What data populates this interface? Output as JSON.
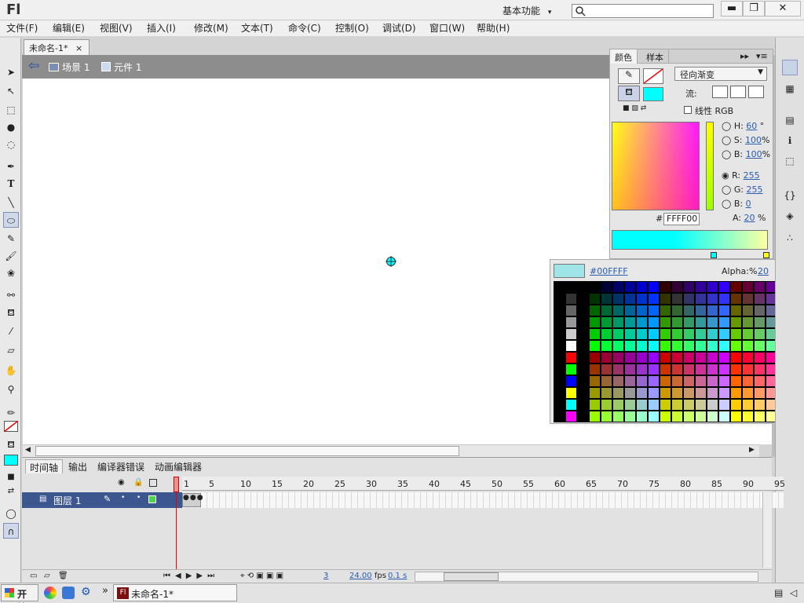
{
  "app": {
    "logo": "Fl",
    "workspace": "基本功能",
    "search_placeholder": ""
  },
  "window_controls": {
    "minimize": "▬",
    "restore": "❐",
    "close": "✕"
  },
  "menu": [
    "文件(F)",
    "编辑(E)",
    "视图(V)",
    "插入(I)",
    "修改(M)",
    "文本(T)",
    "命令(C)",
    "控制(O)",
    "调试(D)",
    "窗口(W)",
    "帮助(H)"
  ],
  "document": {
    "tab_title": "未命名-1*",
    "tab_close": "×"
  },
  "edit_bar": {
    "back_arrow": "⇦",
    "scene": "场景 1",
    "symbol": "元件 1"
  },
  "color_panel": {
    "tabs": [
      "颜色",
      "样本"
    ],
    "fill_type": "径向渐变",
    "flow_label": "流:",
    "linear_rgb_label": "线性 RGB",
    "hsb": [
      {
        "label": "H:",
        "value": "60",
        "unit": "°"
      },
      {
        "label": "S:",
        "value": "100",
        "unit": "%"
      },
      {
        "label": "B:",
        "value": "100",
        "unit": "%"
      }
    ],
    "rgb": [
      {
        "label": "R:",
        "value": "255"
      },
      {
        "label": "G:",
        "value": "255"
      },
      {
        "label": "B:",
        "value": "0"
      }
    ],
    "alpha_label": "A:",
    "alpha_value": "20",
    "alpha_unit": "%",
    "hex_prefix": "#",
    "hex_value": "FFFF00",
    "fill_color": "#00FFFF",
    "gradient_left": "#00FFFF",
    "gradient_right": "#FFFF00"
  },
  "swatch_popup": {
    "hex": "#00FFFF",
    "alpha_label": "Alpha:%",
    "alpha_value": "20"
  },
  "timeline": {
    "tabs": [
      "时间轴",
      "输出",
      "编译器错误",
      "动画编辑器"
    ],
    "layer_name": "图层 1",
    "frame_labels": [
      "1",
      "5",
      "10",
      "15",
      "20",
      "25",
      "30",
      "35",
      "40",
      "45",
      "50",
      "55",
      "60",
      "65",
      "70",
      "75",
      "80",
      "85",
      "90",
      "95"
    ],
    "current_frame": "3",
    "fps": "24.00",
    "fps_unit": "fps",
    "time": "0.1 s"
  },
  "taskbar": {
    "start": "开始",
    "task": "未命名-1*",
    "chevron": "»"
  }
}
